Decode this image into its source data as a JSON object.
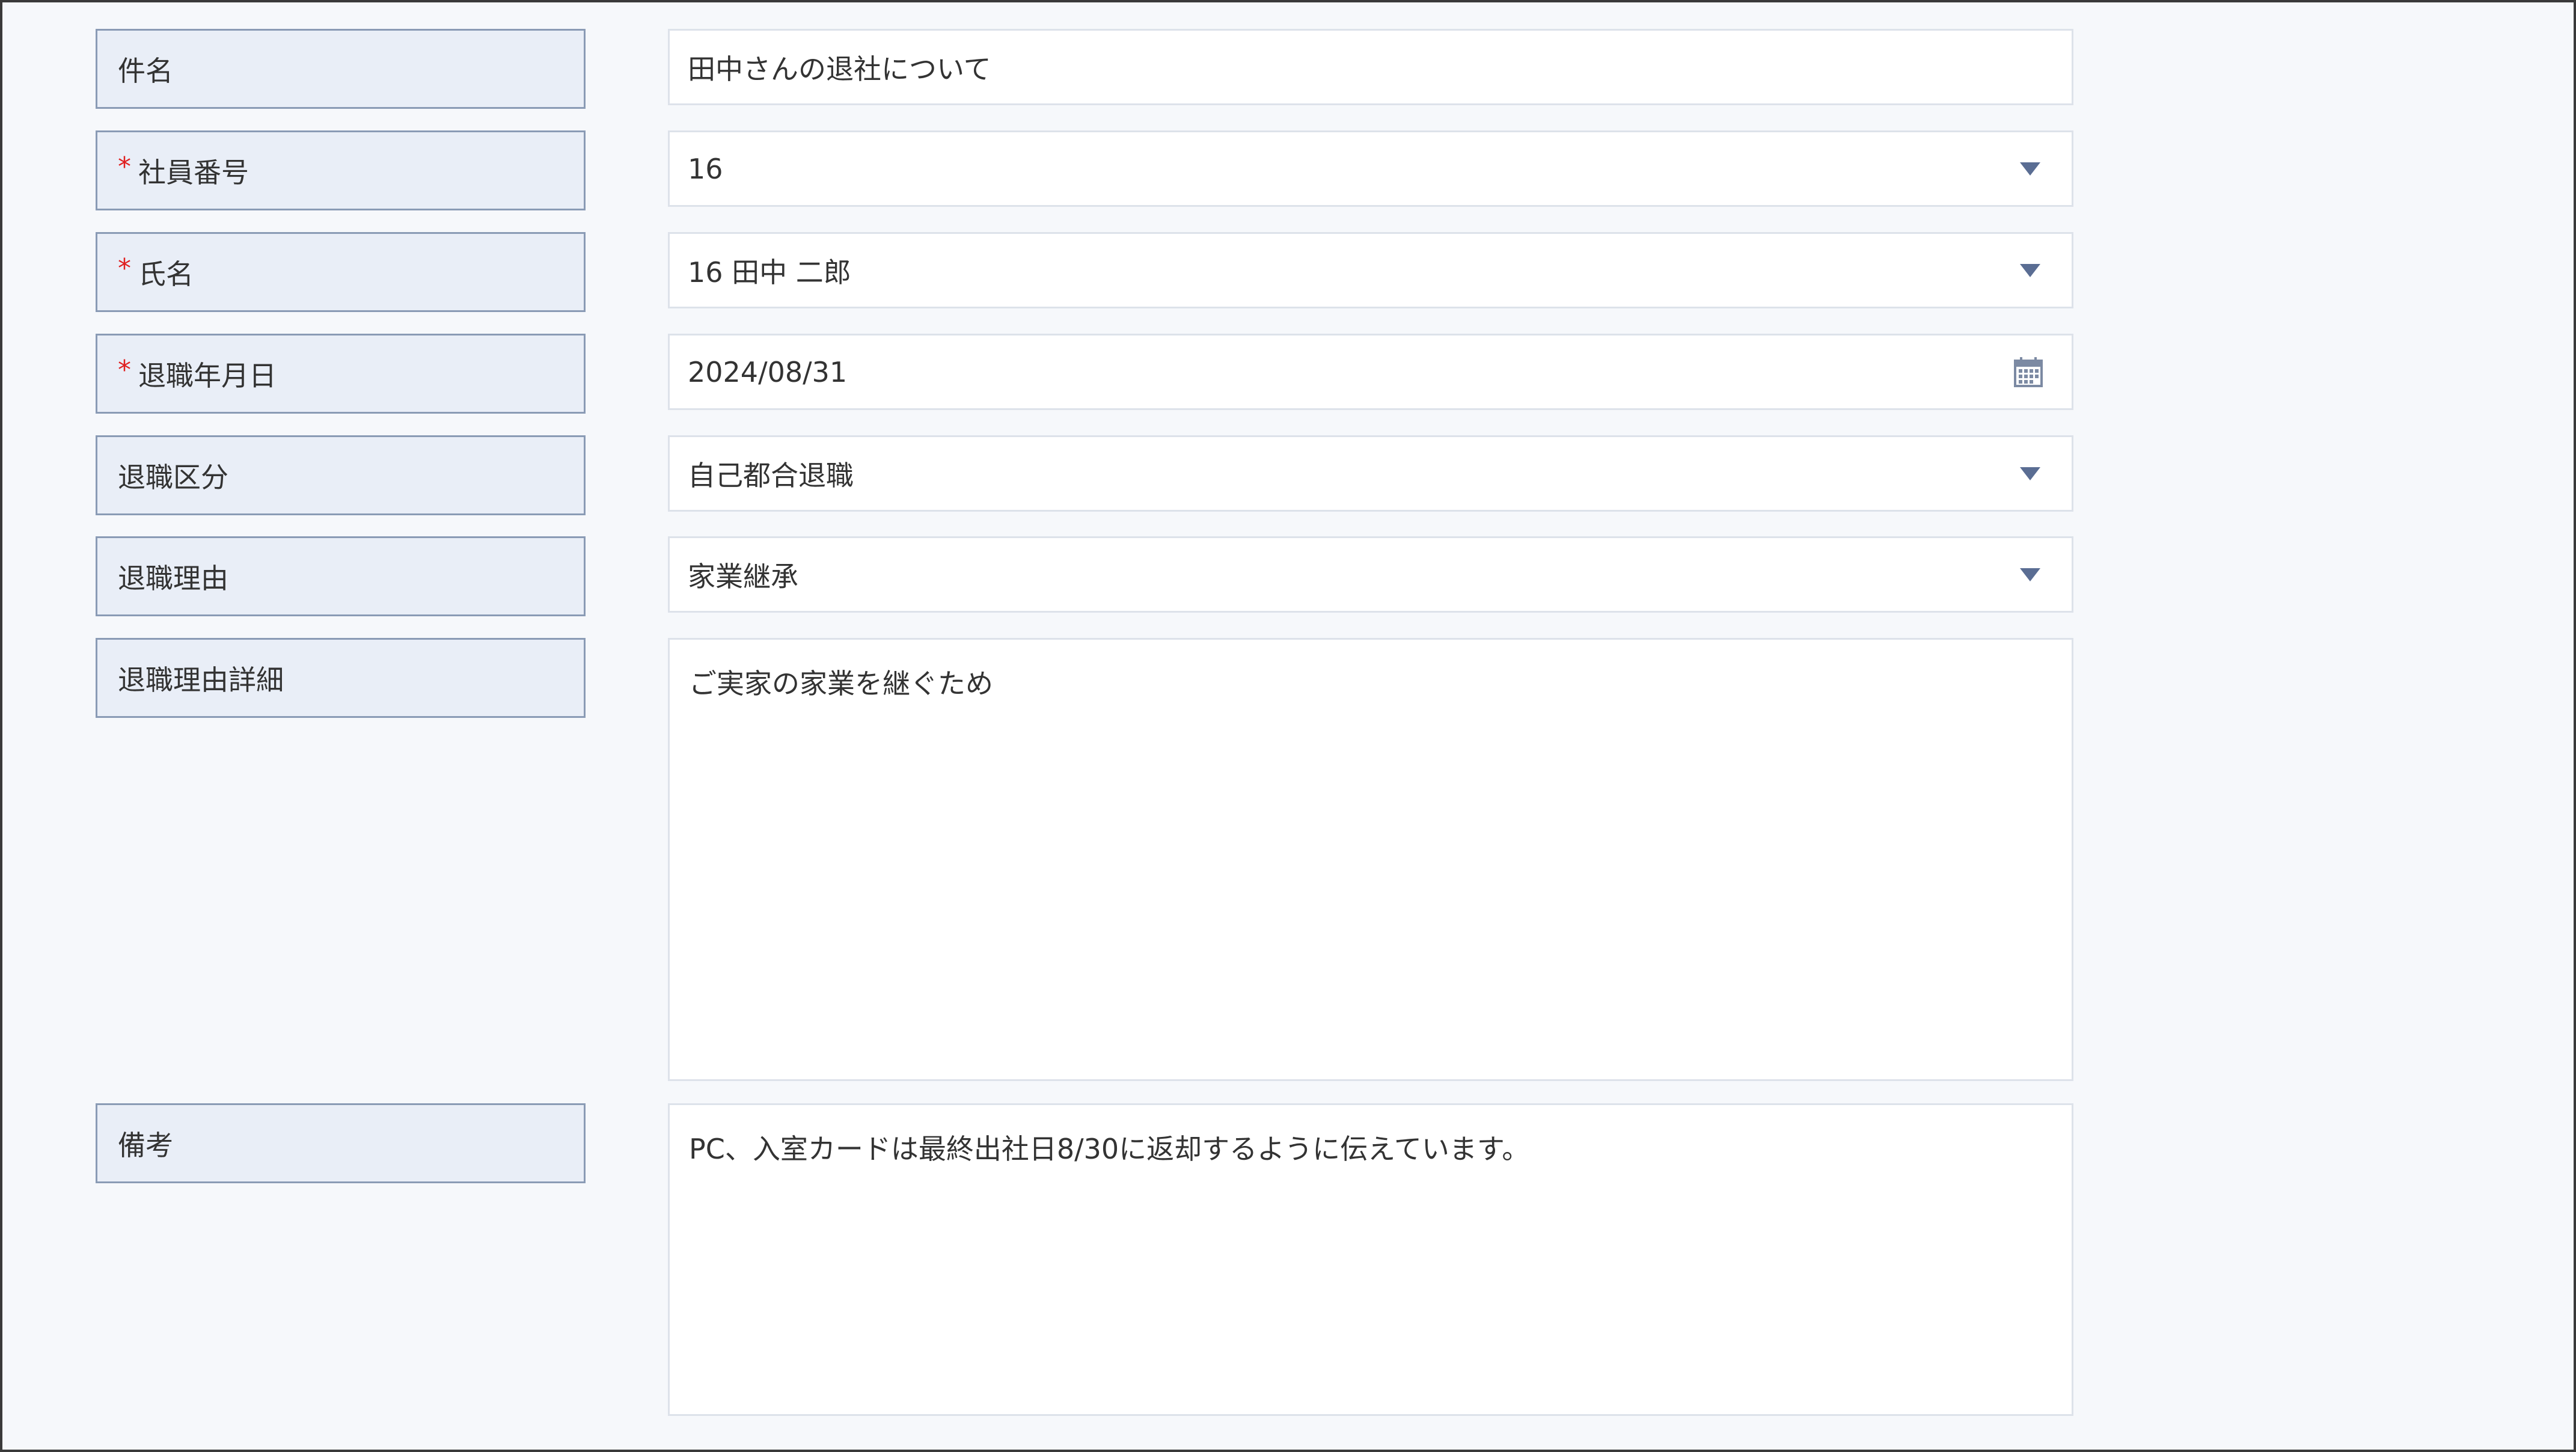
{
  "form": {
    "subject": {
      "label": "件名",
      "value": "田中さんの退社について"
    },
    "employee_number": {
      "required_mark": "*",
      "label": "社員番号",
      "value": "16"
    },
    "name": {
      "required_mark": "*",
      "label": "氏名",
      "value": "16 田中 二郎"
    },
    "retirement_date": {
      "required_mark": "*",
      "label": "退職年月日",
      "value": "2024/08/31",
      "icon": "calendar-icon"
    },
    "retirement_type": {
      "label": "退職区分",
      "value": "自己都合退職"
    },
    "retirement_reason": {
      "label": "退職理由",
      "value": "家業継承"
    },
    "retirement_reason_detail": {
      "label": "退職理由詳細",
      "value": "ご実家の家業を継ぐため"
    },
    "remarks": {
      "label": "備考",
      "value": "PC、入室カードは最終出社日8/30に返却するように伝えています。"
    }
  },
  "colors": {
    "label_bg": "#e9eef7",
    "label_border": "#8a9bb5",
    "required": "#e02020",
    "caret": "#5a6d93",
    "page_bg": "#f6f8fb"
  }
}
